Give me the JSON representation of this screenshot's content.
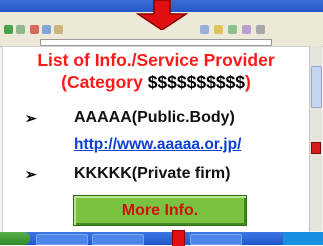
{
  "slide": {
    "title_line1": "List of Info./Service Provider",
    "title_line2_prefix": "(Category ",
    "title_line2_value": "$$$$$$$$$$",
    "title_line2_suffix": ")",
    "bullet_symbol": "➢",
    "items": [
      {
        "label": "AAAAA(Public.Body)",
        "link": "http://www.aaaaa.or.jp/"
      },
      {
        "label": "KKKKK(Private firm)"
      }
    ],
    "more_button_label": "More Info."
  },
  "colors": {
    "title": "#ff1a1a",
    "link": "#0b3fd6",
    "button_fill": "#79c340",
    "button_text": "#d40f0f",
    "arrow": "#e01010"
  }
}
